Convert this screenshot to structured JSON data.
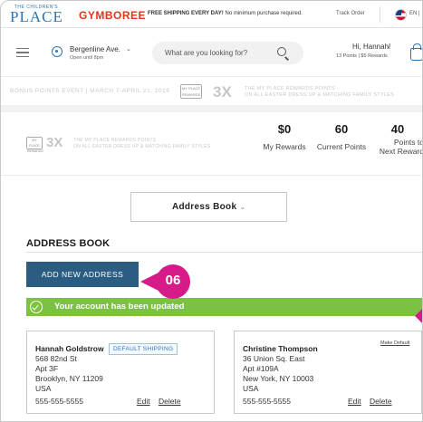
{
  "promo_bar": {
    "logo_small": "THE CHILDREN'S",
    "logo_big": "PLACE",
    "gymboree_logo": "GYMBOREE",
    "promo_bold": "FREE SHIPPING EVERY DAY!",
    "promo_rest": " No minimum purchase required.",
    "track_order": "Track Order",
    "language": "EN |"
  },
  "header": {
    "store_name": "Bergenline Ave.",
    "store_hours": "Open until 8pm",
    "search_placeholder": "What are you looking for?",
    "greeting": "Hi, Hannah!",
    "points_summary": "13 Points  |  $5 Rewards"
  },
  "event_banner": {
    "text": "BONUS POINTS EVENT  |  MARCH 7-APRIL 21, 2019",
    "logo_text": "MY PLACE REWARDS",
    "multiplier": "3X",
    "line1": "THE MY PLACE REWARDS POINTS",
    "line2": "ON ALL EASTER DRESS UP & MATCHING FAMILY STYLES"
  },
  "rewards_row": {
    "logo_text": "MY PLACE REWARDS",
    "multiplier": "3X",
    "line1": "THE MY PLACE REWARDS POINTS",
    "line2": "ON ALL EASTER DRESS UP & MATCHING FAMILY STYLES",
    "my_rewards_value": "$0",
    "my_rewards_label": "My Rewards",
    "current_points_value": "60",
    "current_points_label": "Current Points",
    "next_reward_value": "40",
    "next_reward_label_1": "Points to",
    "next_reward_label_2": "Next Reward"
  },
  "account_nav": {
    "selected": "Address Book"
  },
  "page": {
    "title": "ADDRESS BOOK",
    "add_button": "ADD NEW ADDRESS",
    "success_message": "Your account has been updated",
    "callout_number": "06"
  },
  "addresses": [
    {
      "name": "Hannah Goldstrow",
      "street": "568 82nd St",
      "unit": "Apt 3F",
      "city_state_zip": "Brooklyn, NY 11209",
      "country": "USA",
      "phone": "555-555-5555",
      "badge": "DEFAULT SHIPPING",
      "edit": "Edit",
      "delete": "Delete"
    },
    {
      "name": "Christine Thompson",
      "street": "36 Union Sq. East",
      "unit": "Apt #109A",
      "city_state_zip": "New York, NY 10003",
      "country": "USA",
      "phone": "555-555-5555",
      "make_default": "Make Default",
      "edit": "Edit",
      "delete": "Delete"
    }
  ],
  "colors": {
    "brand_blue": "#2d74b4",
    "button_navy": "#2a5d81",
    "success_green": "#7cc242",
    "callout_magenta": "#d61a8a",
    "gymboree_red": "#e0361b"
  }
}
